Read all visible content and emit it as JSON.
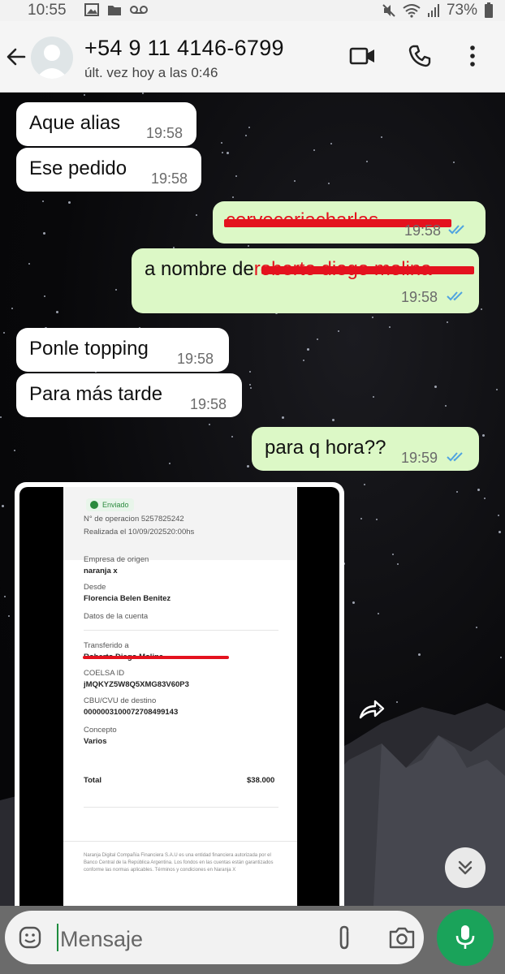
{
  "status_bar": {
    "time": "10:55",
    "battery": "73%"
  },
  "header": {
    "contact": "+54 9 11 4146-6799",
    "last_seen": "últ. vez hoy a las 0:46"
  },
  "messages": [
    {
      "dir": "in",
      "text": "Aque alias",
      "time": "19:58"
    },
    {
      "dir": "in",
      "text": "Ese pedido",
      "time": "19:58"
    },
    {
      "dir": "out",
      "text": "cerveceriacharlas",
      "time": "19:58",
      "redacted": true
    },
    {
      "dir": "out",
      "text_prefix": "a nombre de",
      "text_redacted": "roberto diego molina",
      "time": "19:58"
    },
    {
      "dir": "in",
      "text": "Ponle topping",
      "time": "19:58"
    },
    {
      "dir": "in",
      "text": "Para más tarde",
      "time": "19:58"
    },
    {
      "dir": "out",
      "text": "para q hora??",
      "time": "19:59"
    }
  ],
  "receipt": {
    "status": "Enviado",
    "operation": "N° de operacion 5257825242",
    "date": "Realizada el 10/09/202520:00hs",
    "origin_label": "Empresa de origen",
    "origin_value": "naranja x",
    "from_label": "Desde",
    "from_value": "Florencia Belen Benitez",
    "account_label": "Datos de la cuenta",
    "to_label": "Transferido a",
    "to_value": "Roberto Diego Molina",
    "coelsa_label": "COELSA ID",
    "coelsa_value": "jMQKYZ5W8Q5XMG83V60P3",
    "cbu_label": "CBU/CVU de destino",
    "cbu_value": "0000003100072708499143",
    "concept_label": "Concepto",
    "concept_value": "Varios",
    "total_label": "Total",
    "total_value": "$38.000",
    "footer": "Naranja Digital Compañía Financiera S.A.U es una entidad financiera autorizada por el Banco Central de la República Argentina. Los fondos en las cuentas están garantizados conforme las normas aplicables. Términos y condiciones en Naranja X"
  },
  "composer": {
    "placeholder": "Mensaje"
  },
  "colors": {
    "incoming": "#ffffff",
    "outgoing": "#dcf8c6",
    "accent": "#1aa35a",
    "redaction": "#e4121e",
    "read_ticks": "#4fa3e0"
  },
  "icons": [
    "back-arrow-icon",
    "avatar-icon",
    "video-call-icon",
    "phone-icon",
    "more-vert-icon",
    "forward-icon",
    "chevron-double-down-icon",
    "emoji-icon",
    "attach-icon",
    "camera-icon",
    "mic-icon"
  ]
}
